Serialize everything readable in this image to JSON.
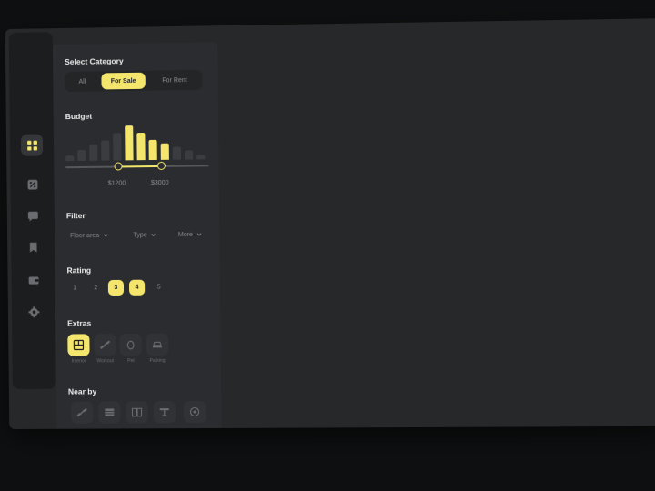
{
  "colors": {
    "accent": "#f4e66c",
    "panel": "#2a2c2f",
    "rail": "#1c1d1f",
    "background": "#0e0f10"
  },
  "sidebar": {
    "items": [
      {
        "icon": "grid-icon",
        "active": true
      },
      {
        "icon": "percent-tag-icon",
        "active": false
      },
      {
        "icon": "chat-icon",
        "active": false
      },
      {
        "icon": "bookmark-icon",
        "active": false
      },
      {
        "icon": "wallet-icon",
        "active": false
      },
      {
        "icon": "gear-icon",
        "active": false
      }
    ]
  },
  "category": {
    "title": "Select Category",
    "options": [
      "All",
      "For Sale",
      "For Rent"
    ],
    "selected": "For Sale"
  },
  "budget": {
    "title": "Budget",
    "histogram": [
      0.15,
      0.3,
      0.45,
      0.55,
      0.75,
      0.95,
      0.75,
      0.55,
      0.45,
      0.35,
      0.25,
      0.12
    ],
    "selected_range_bars": [
      5,
      6,
      7,
      8
    ],
    "min_label": "$1200",
    "max_label": "$3000"
  },
  "filter": {
    "title": "Filter",
    "dropdowns": [
      "Floor area",
      "Type",
      "More"
    ]
  },
  "rating": {
    "title": "Rating",
    "options": [
      "1",
      "2",
      "3",
      "4",
      "5"
    ],
    "selected": [
      "3",
      "4"
    ]
  },
  "extras": {
    "title": "Extras",
    "items": [
      {
        "label": "Interior",
        "icon": "floorplan-icon",
        "active": true
      },
      {
        "label": "Workout",
        "icon": "dumbbell-icon",
        "active": false
      },
      {
        "label": "Pet",
        "icon": "egg-icon",
        "active": false
      },
      {
        "label": "Parking",
        "icon": "car-icon",
        "active": false
      }
    ]
  },
  "nearby": {
    "title": "Near by",
    "items": [
      "dumbbell-icon",
      "building-icon",
      "book-icon",
      "table-icon",
      "ball-icon"
    ]
  }
}
